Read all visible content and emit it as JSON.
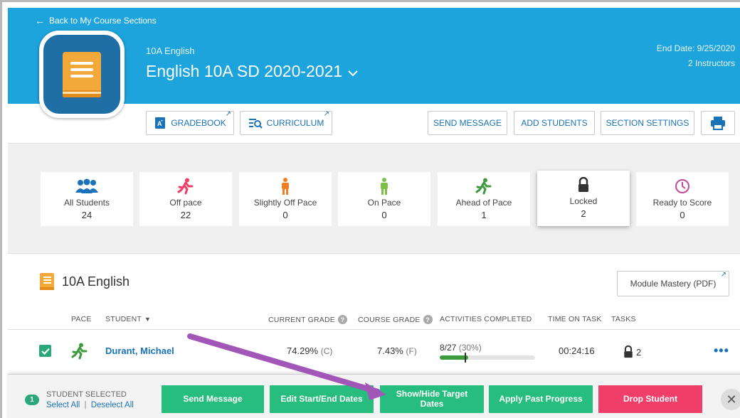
{
  "header": {
    "back_link": "Back to My Course Sections",
    "course_code": "10A English",
    "course_title": "English 10A SD 2020-2021",
    "end_date": "End Date: 9/25/2020",
    "instructors": "2 Instructors",
    "bg_color": "#1ea4dc"
  },
  "toolbar": {
    "gradebook": "GRADEBOOK",
    "curriculum": "CURRICULUM",
    "send_message": "SEND MESSAGE",
    "add_students": "ADD STUDENTS",
    "section_settings": "SECTION SETTINGS",
    "print_icon": "printer-icon"
  },
  "stats": [
    {
      "label": "All Students",
      "count": "24",
      "icon": "group-icon",
      "color": "#1a72b8"
    },
    {
      "label": "Off pace",
      "count": "22",
      "icon": "running-person-icon",
      "color": "#ef3e68"
    },
    {
      "label": "Slightly Off Pace",
      "count": "0",
      "icon": "standing-person-icon",
      "color": "#f07f22"
    },
    {
      "label": "On Pace",
      "count": "0",
      "icon": "standing-person-icon",
      "color": "#7ac143"
    },
    {
      "label": "Ahead of Pace",
      "count": "1",
      "icon": "running-person-icon",
      "color": "#3e9b3d"
    },
    {
      "label": "Locked",
      "count": "2",
      "icon": "lock-icon",
      "color": "#333333"
    },
    {
      "label": "Ready to Score",
      "count": "0",
      "icon": "clock-icon",
      "color": "#c24a9b"
    }
  ],
  "section": {
    "title": "10A English",
    "pdf_button": "Module Mastery (PDF)"
  },
  "table": {
    "headers": {
      "pace": "PACE",
      "student": "STUDENT",
      "current_grade": "CURRENT GRADE",
      "course_grade": "COURSE GRADE",
      "activities": "ACTIVITIES COMPLETED",
      "time_on_task": "TIME ON TASK",
      "tasks": "TASKS"
    },
    "rows": [
      {
        "selected": true,
        "pace_icon": "running-person-icon",
        "student": "Durant, Michael",
        "current_grade": "74.29%",
        "current_letter": "(C)",
        "course_grade": "7.43%",
        "course_letter": "(F)",
        "activities_done": "8/27",
        "activities_pct_text": "(30%)",
        "activities_fraction": 0.3,
        "target_fraction": 0.26,
        "time_on_task": "00:24:16",
        "tasks_count": "2",
        "more": "•••"
      }
    ]
  },
  "action_bar": {
    "selected_count": "1",
    "selected_label": "STUDENT SELECTED",
    "select_all": "Select All",
    "separator": "|",
    "deselect_all": "Deselect All",
    "send_message": "Send Message",
    "edit_dates": "Edit Start/End Dates",
    "show_hide_line1": "Show/Hide Target",
    "show_hide_line2": "Dates",
    "apply_progress": "Apply Past Progress",
    "drop_student": "Drop Student",
    "close": "✕"
  },
  "colors": {
    "accent_green": "#26bd7e",
    "danger_red": "#ef3e68",
    "link_blue": "#1a72b8",
    "annotation_purple": "#a257b8"
  }
}
